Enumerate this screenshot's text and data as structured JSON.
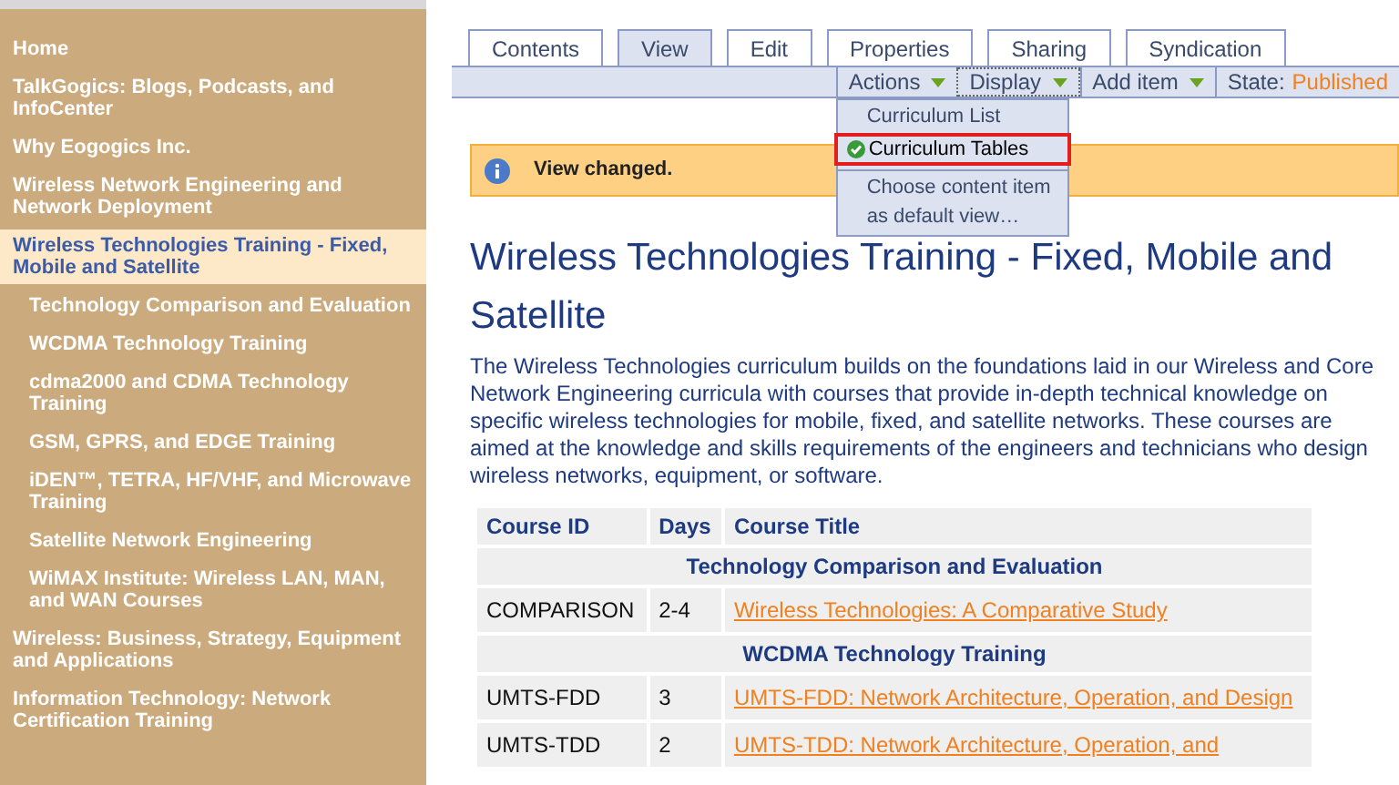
{
  "sidebar": {
    "items": [
      {
        "label": "Home",
        "selected": false
      },
      {
        "label": "TalkGogics: Blogs, Podcasts, and InfoCenter",
        "selected": false
      },
      {
        "label": "Why Eogogics Inc.",
        "selected": false
      },
      {
        "label": "Wireless Network Engineering and Network Deployment",
        "selected": false
      },
      {
        "label": "Wireless Technologies Training - Fixed, Mobile and Satellite",
        "selected": true,
        "children": [
          {
            "label": "Technology Comparison and Evaluation",
            "selected": false
          },
          {
            "label": "WCDMA Technology Training",
            "selected": false
          },
          {
            "label": "cdma2000 and CDMA Technology Training",
            "selected": false
          },
          {
            "label": "GSM, GPRS, and EDGE Training",
            "selected": false
          },
          {
            "label": "iDEN™, TETRA, HF/VHF, and Microwave Training",
            "selected": false
          },
          {
            "label": "Satellite Network Engineering",
            "selected": false
          },
          {
            "label": "WiMAX Institute: Wireless LAN, MAN, and WAN Courses",
            "selected": false
          }
        ]
      },
      {
        "label": "Wireless: Business, Strategy, Equipment and Applications",
        "selected": false
      },
      {
        "label": "Information Technology: Network Certification Training",
        "selected": false
      }
    ]
  },
  "tabs": [
    {
      "label": "Contents",
      "selected": false
    },
    {
      "label": "View",
      "selected": true
    },
    {
      "label": "Edit",
      "selected": false
    },
    {
      "label": "Properties",
      "selected": false
    },
    {
      "label": "Sharing",
      "selected": false
    },
    {
      "label": "Syndication",
      "selected": false
    }
  ],
  "toolbar": {
    "menus": [
      {
        "label": "Actions",
        "expanded": false
      },
      {
        "label": "Display",
        "expanded": true,
        "items": [
          {
            "kind": "option",
            "label": "Curriculum List",
            "selected": false
          },
          {
            "kind": "option",
            "label": "Curriculum Tables",
            "selected": true
          },
          {
            "kind": "action",
            "label": "Choose content item as default view…"
          }
        ]
      },
      {
        "label": "Add item",
        "expanded": false
      }
    ],
    "state": {
      "label": "State:",
      "value": "Published"
    }
  },
  "message": {
    "text": "View changed."
  },
  "title": "Wireless Technologies Training - Fixed, Mobile and Satellite",
  "description": "The Wireless Technologies curriculum builds on the foundations laid in our Wireless and Core Network Engineering curricula with courses that provide in-depth technical knowledge on specific wireless technologies for mobile, fixed, and satellite networks. These courses are aimed at the knowledge and skills requirements of the engineers and technicians who design wireless networks, equipment, or software.",
  "table": {
    "columns": [
      "Course ID",
      "Days",
      "Course Title"
    ],
    "rows": [
      {
        "kind": "section",
        "title": "Technology Comparison and Evaluation"
      },
      {
        "kind": "course",
        "id": "COMPARISON",
        "days": "2-4",
        "title": "Wireless Technologies: A Comparative Study"
      },
      {
        "kind": "section",
        "title": "WCDMA Technology Training"
      },
      {
        "kind": "course",
        "id": "UMTS-FDD",
        "days": "3",
        "title": "UMTS-FDD: Network Architecture, Operation, and Design"
      },
      {
        "kind": "course",
        "id": "UMTS-TDD",
        "days": "2",
        "title": "UMTS-TDD: Network Architecture, Operation, and"
      }
    ]
  }
}
